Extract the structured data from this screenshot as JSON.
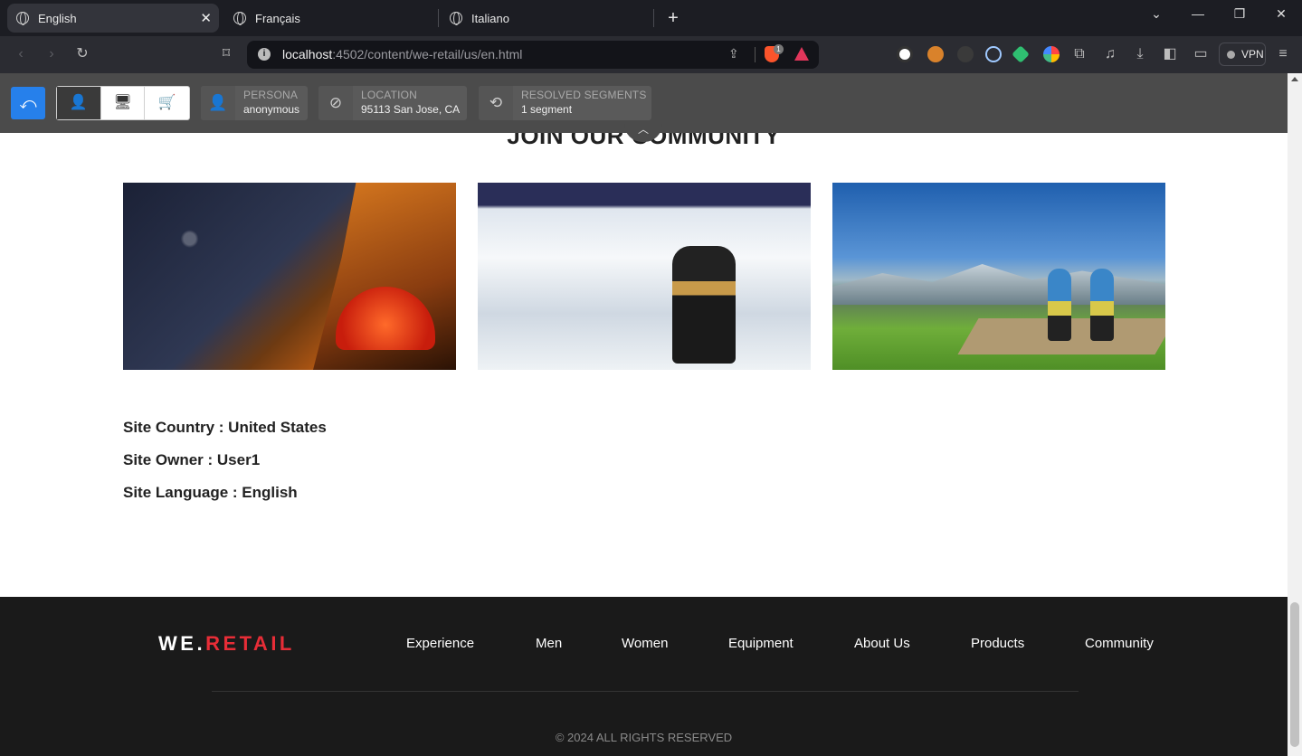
{
  "browser": {
    "tabs": [
      {
        "label": "English",
        "active": true
      },
      {
        "label": "Français",
        "active": false
      },
      {
        "label": "Italiano",
        "active": false
      }
    ],
    "url_host": "localhost",
    "url_rest": ":4502/content/we-retail/us/en.html",
    "brave_badge": "1",
    "vpn_label": "VPN"
  },
  "contexthub": {
    "persona": {
      "title": "PERSONA",
      "value": "anonymous"
    },
    "location": {
      "title": "LOCATION",
      "value": "95113 San Jose, CA"
    },
    "segments": {
      "title": "RESOLVED SEGMENTS",
      "value": "1 segment"
    }
  },
  "community": {
    "title": "JOIN OUR COMMUNITY"
  },
  "site_info": {
    "country": "Site Country : United States",
    "owner": "Site Owner : User1",
    "language": "Site Language : English"
  },
  "footer": {
    "logo_white": "WE.",
    "logo_red": "RETAIL",
    "nav": [
      "Experience",
      "Men",
      "Women",
      "Equipment",
      "About Us",
      "Products",
      "Community"
    ],
    "copyright": "© 2024 ALL RIGHTS RESERVED"
  }
}
